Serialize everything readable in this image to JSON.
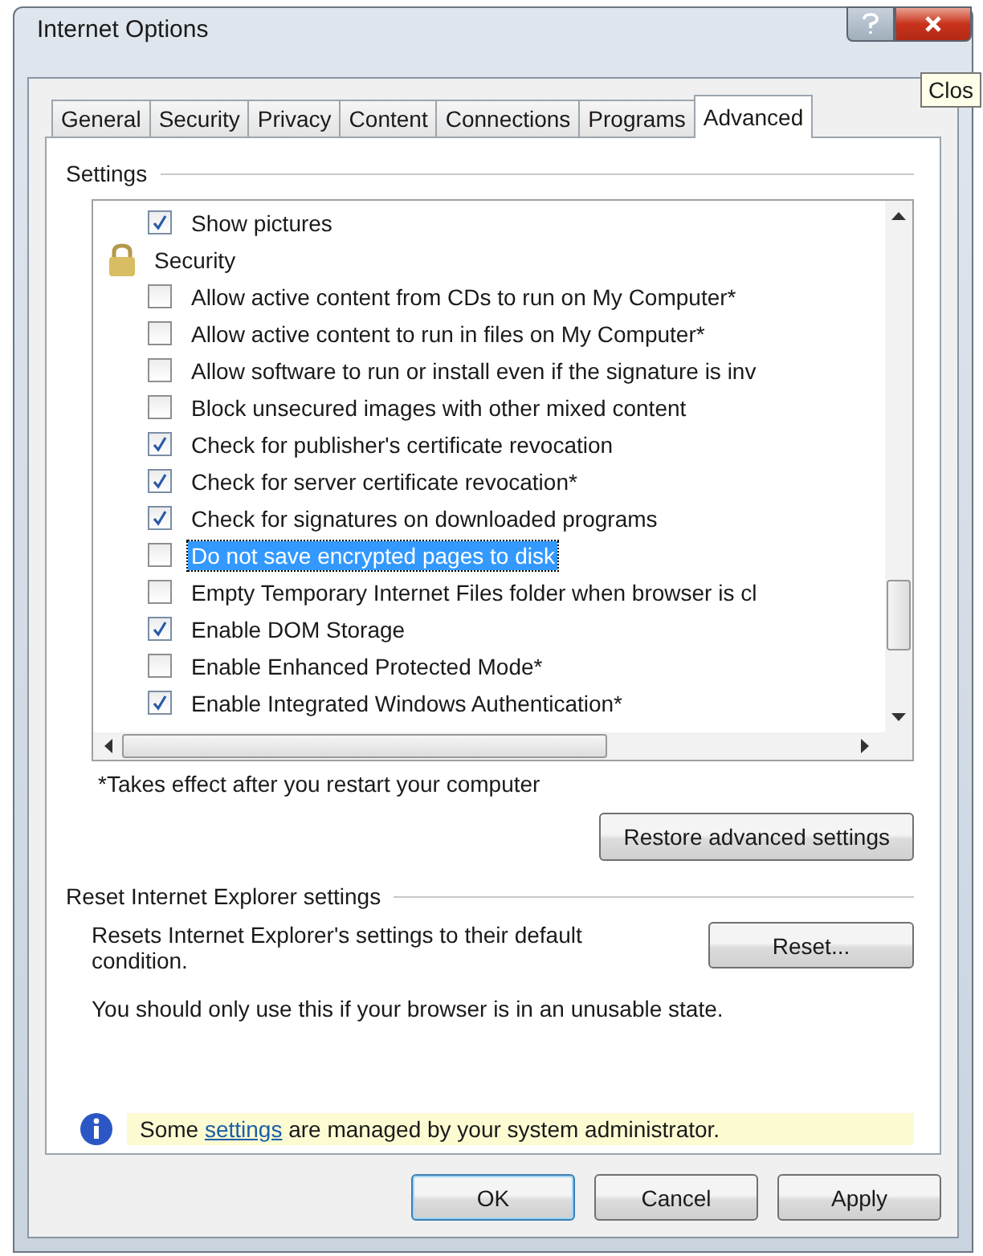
{
  "window": {
    "title": "Internet Options",
    "tooltip": "Clos"
  },
  "tabs": [
    {
      "label": "General",
      "selected": false
    },
    {
      "label": "Security",
      "selected": false
    },
    {
      "label": "Privacy",
      "selected": false
    },
    {
      "label": "Content",
      "selected": false
    },
    {
      "label": "Connections",
      "selected": false
    },
    {
      "label": "Programs",
      "selected": false
    },
    {
      "label": "Advanced",
      "selected": true
    }
  ],
  "settings": {
    "heading": "Settings",
    "items": [
      {
        "kind": "checkbox",
        "label": "Show pictures",
        "checked": true,
        "selected": false
      },
      {
        "kind": "group",
        "label": "Security",
        "selected": false
      },
      {
        "kind": "checkbox",
        "label": "Allow active content from CDs to run on My Computer*",
        "checked": false,
        "selected": false
      },
      {
        "kind": "checkbox",
        "label": "Allow active content to run in files on My Computer*",
        "checked": false,
        "selected": false
      },
      {
        "kind": "checkbox",
        "label": "Allow software to run or install even if the signature is inv",
        "checked": false,
        "selected": false
      },
      {
        "kind": "checkbox",
        "label": "Block unsecured images with other mixed content",
        "checked": false,
        "selected": false
      },
      {
        "kind": "checkbox",
        "label": "Check for publisher's certificate revocation",
        "checked": true,
        "selected": false
      },
      {
        "kind": "checkbox",
        "label": "Check for server certificate revocation*",
        "checked": true,
        "selected": false
      },
      {
        "kind": "checkbox",
        "label": "Check for signatures on downloaded programs",
        "checked": true,
        "selected": false
      },
      {
        "kind": "checkbox",
        "label": "Do not save encrypted pages to disk",
        "checked": false,
        "selected": true
      },
      {
        "kind": "checkbox",
        "label": "Empty Temporary Internet Files folder when browser is cl",
        "checked": false,
        "selected": false
      },
      {
        "kind": "checkbox",
        "label": "Enable DOM Storage",
        "checked": true,
        "selected": false
      },
      {
        "kind": "checkbox",
        "label": "Enable Enhanced Protected Mode*",
        "checked": false,
        "selected": false
      },
      {
        "kind": "checkbox",
        "label": "Enable Integrated Windows Authentication*",
        "checked": true,
        "selected": false
      }
    ],
    "footnote": "*Takes effect after you restart your computer",
    "restore_button": "Restore advanced settings"
  },
  "reset": {
    "heading": "Reset Internet Explorer settings",
    "description": "Resets Internet Explorer's settings to their default condition.",
    "button": "Reset...",
    "warning": "You should only use this if your browser is in an unusable state."
  },
  "info_bar": {
    "before": "Some",
    "link": "settings",
    "after": "are managed by your system administrator."
  },
  "buttons": [
    {
      "label": "OK",
      "kind": "default"
    },
    {
      "label": "Cancel",
      "kind": "normal"
    },
    {
      "label": "Apply",
      "kind": "normal"
    }
  ]
}
